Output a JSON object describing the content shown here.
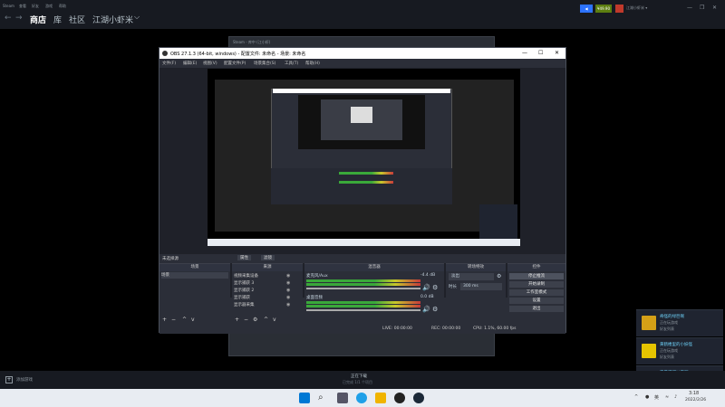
{
  "steam": {
    "menu": [
      "Steam",
      "查看",
      "好友",
      "游戏",
      "帮助"
    ],
    "nav": {
      "store": "商店",
      "library": "库",
      "community": "社区",
      "username": "江湖小虾米"
    },
    "topbar": {
      "balance": "¥49.90",
      "user_label": "江湖小虾米 ▾",
      "window_controls": [
        "—",
        "❐",
        "✕"
      ]
    },
    "bottom": {
      "add_game": "添加游戏",
      "downloads_title": "正在下载",
      "downloads_sub": "已完成 1/1 个项目"
    }
  },
  "inner_steam": {
    "title": "Steam - 库中 (江小虾)"
  },
  "obs": {
    "title": "OBS 27.1.3 (64-bit, windows) - 配置文件: 未命名 - 场景: 未命名",
    "menu": [
      "文件(F)",
      "编辑(E)",
      "视图(V)",
      "配置文件(P)",
      "场景集合(S)",
      "工具(T)",
      "帮助(H)"
    ],
    "window_controls": [
      "—",
      "☐",
      "✕"
    ],
    "preview": {
      "no_source": "未选择源",
      "properties": "属性",
      "filters": "滤镜"
    },
    "scenes": {
      "header": "场景",
      "items": [
        "场景"
      ]
    },
    "sources": {
      "header": "来源",
      "items": [
        "视频采集设备",
        "显示捕获 3",
        "显示捕获 2",
        "显示捕获",
        "显示器采集"
      ]
    },
    "mixer": {
      "header": "混音器",
      "tracks": [
        {
          "name": "麦克风/Aux",
          "db": "-4.4 dB"
        },
        {
          "name": "桌面音频",
          "db": "0.0 dB"
        }
      ]
    },
    "transitions": {
      "header": "转场特效",
      "type": "淡出",
      "duration_label": "时长",
      "duration": "300 ms"
    },
    "controls": {
      "header": "控件",
      "buttons": [
        "停止推流",
        "开始录制",
        "工作室模式",
        "设置",
        "退出"
      ]
    },
    "status": {
      "live": "LIVE: 00:00:00",
      "rec": "REC: 00:00:00",
      "cpu": "CPU: 1.1%, 60.00 fps"
    }
  },
  "friends": [
    {
      "name": "奇怪的绿巨啊",
      "line1": "正在玩游戏",
      "line2": "好友列表"
    },
    {
      "name": "黄鹤楼里的小妖怪",
      "line1": "正在玩游戏",
      "line2": "好友列表"
    },
    {
      "name": "不是猫可以不啊",
      "line1": "正在玩游戏",
      "line2": "好友列表"
    }
  ],
  "taskbar": {
    "time": "3:18",
    "date": "2022/2/26",
    "lang": "英"
  },
  "colors": {
    "obs_bg": "#2b2e38",
    "steam_dark": "#171a21",
    "accent": "#2d73ff",
    "balance_green": "#5c7e10"
  }
}
